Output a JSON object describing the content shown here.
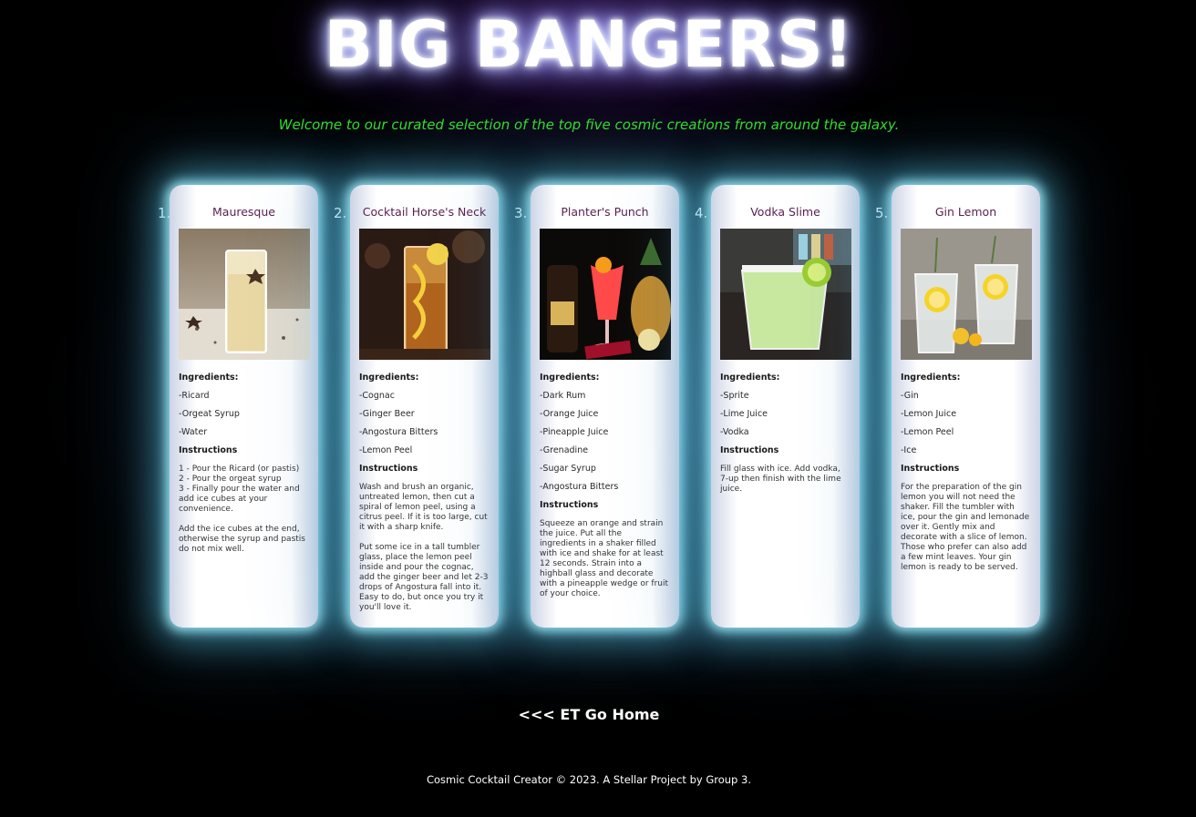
{
  "header": {
    "title": "BIG BANGERS!",
    "subtitle": "Welcome to our curated selection of the top five cosmic creations from around the galaxy."
  },
  "labels": {
    "ingredients": "Ingredients:",
    "instructions": "Instructions"
  },
  "cocktails": [
    {
      "number": "1.",
      "name": "Mauresque",
      "ingredients": [
        "-Ricard",
        "-Orgeat Syrup",
        "-Water"
      ],
      "instructions": "1 - Pour the Ricard (or pastis)\n2 - Pour the orgeat syrup\n3 - Finally pour the water and add ice cubes at your convenience.\n\nAdd the ice cubes at the end, otherwise the syrup and pastis do not mix well."
    },
    {
      "number": "2.",
      "name": "Cocktail Horse's Neck",
      "ingredients": [
        "-Cognac",
        "-Ginger Beer",
        "-Angostura Bitters",
        "-Lemon Peel"
      ],
      "instructions": "Wash and brush an organic, untreated lemon, then cut a spiral of lemon peel, using a citrus peel. If it is too large, cut it with a sharp knife.\n\nPut some ice in a tall tumbler glass, place the lemon peel inside and pour the cognac, add the ginger beer and let 2-3 drops of Angostura fall into it. Easy to do, but once you try it you'll love it."
    },
    {
      "number": "3.",
      "name": "Planter's Punch",
      "ingredients": [
        "-Dark Rum",
        "-Orange Juice",
        "-Pineapple Juice",
        "-Grenadine",
        "-Sugar Syrup",
        "-Angostura Bitters"
      ],
      "instructions": "Squeeze an orange and strain the juice. Put all the ingredients in a shaker filled with ice and shake for at least 12 seconds. Strain into a highball glass and decorate with a pineapple wedge or fruit of your choice."
    },
    {
      "number": "4.",
      "name": "Vodka Slime",
      "ingredients": [
        "-Sprite",
        "-Lime Juice",
        "-Vodka"
      ],
      "instructions": "Fill glass with ice. Add vodka, 7-up then finish with the lime juice."
    },
    {
      "number": "5.",
      "name": "Gin Lemon",
      "ingredients": [
        "-Gin",
        "-Lemon Juice",
        "-Lemon Peel",
        "-Ice"
      ],
      "instructions": "For the preparation of the gin lemon you will not need the shaker. Fill the tumbler with ice, pour the gin and lemonade over it. Gently mix and decorate with a slice of lemon. Those who prefer can also add a few mint leaves. Your gin lemon is ready to be served."
    }
  ],
  "nav": {
    "home_link": "<<< ET Go Home"
  },
  "footer": {
    "text": "Cosmic Cocktail Creator © 2023. A Stellar Project by Group 3."
  }
}
